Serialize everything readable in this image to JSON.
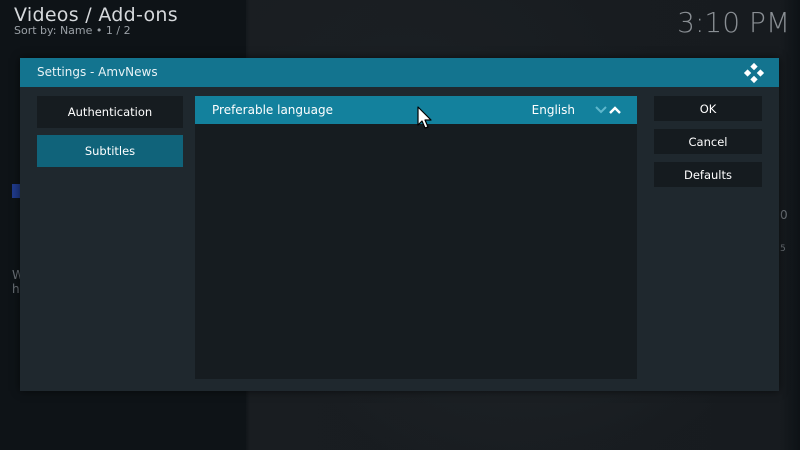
{
  "header": {
    "title": "Videos / Add-ons",
    "subtitle": "Sort by: Name  •  1 / 2",
    "clock": "3:10 PM"
  },
  "dialog": {
    "title": "Settings - AmvNews",
    "categories": [
      {
        "label": "Authentication",
        "selected": false
      },
      {
        "label": "Subtitles",
        "selected": true
      }
    ],
    "settings": [
      {
        "label": "Preferable language",
        "value": "English",
        "focused": true
      }
    ],
    "buttons": {
      "ok": "OK",
      "cancel": "Cancel",
      "defaults": "Defaults"
    }
  },
  "background_fragments": {
    "left_w": "W",
    "left_h": "h",
    "right_0": "0",
    "right_5": "5"
  },
  "colors": {
    "accent": "#13748f",
    "focused_row": "#13819d",
    "selected_category": "#10637a",
    "dialog_bg": "#1f282e"
  },
  "icons": {
    "logo": "kodi-logo-icon",
    "spinner_down": "chevron-down-icon",
    "spinner_up": "chevron-up-icon",
    "pointer": "mouse-pointer-icon"
  }
}
